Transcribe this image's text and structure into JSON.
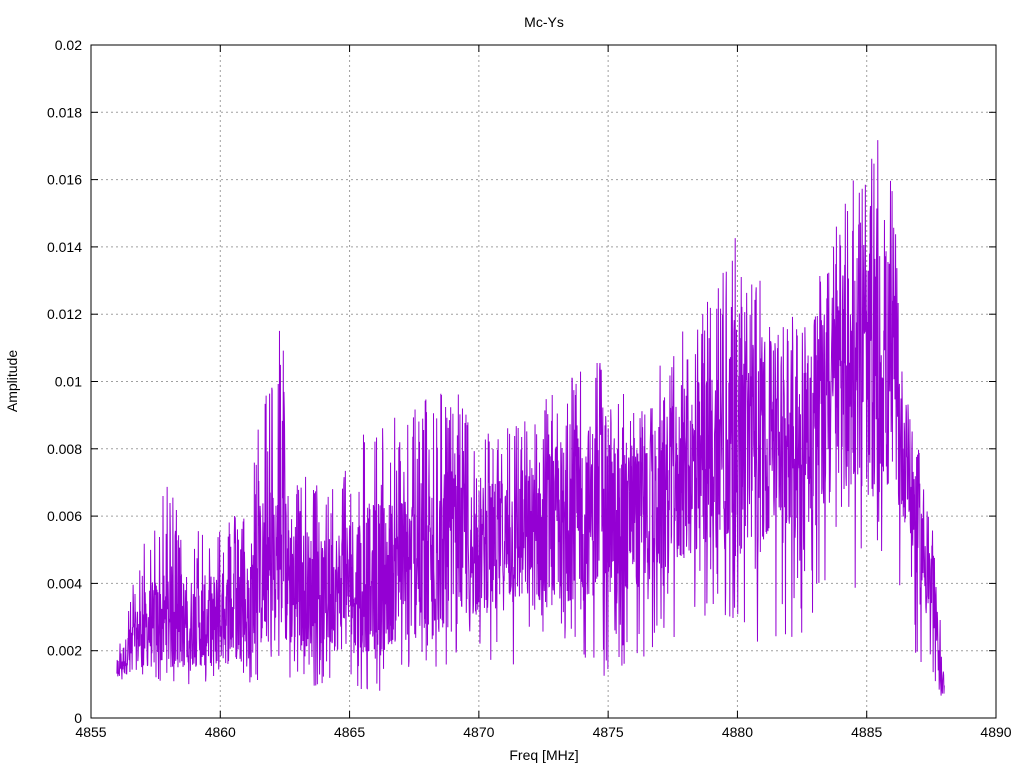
{
  "chart_data": {
    "type": "line",
    "title": "Mc-Ys",
    "xlabel": "Freq [MHz]",
    "ylabel": "Amplitude",
    "xlim": [
      4855,
      4890
    ],
    "ylim": [
      0,
      0.02
    ],
    "x_ticks": [
      "4855",
      "4860",
      "4865",
      "4870",
      "4875",
      "4880",
      "4885",
      "4890"
    ],
    "y_ticks": [
      "0",
      "0.002",
      "0.004",
      "0.006",
      "0.008",
      "0.01",
      "0.012",
      "0.014",
      "0.016",
      "0.018",
      "0.02"
    ],
    "grid": true,
    "line_color": "#9400d3",
    "series": [
      {
        "x_start": 4856,
        "x_end": 4888,
        "envelope": [
          [
            4856.0,
            0.0014,
            0.001,
            0.002
          ],
          [
            4857.0,
            0.0025,
            0.0012,
            0.0052
          ],
          [
            4858.0,
            0.0028,
            0.001,
            0.007
          ],
          [
            4859.0,
            0.0027,
            0.001,
            0.0058
          ],
          [
            4860.0,
            0.0028,
            0.0008,
            0.006
          ],
          [
            4861.0,
            0.003,
            0.001,
            0.0062
          ],
          [
            4861.5,
            0.004,
            0.001,
            0.009
          ],
          [
            4862.3,
            0.0045,
            0.0012,
            0.012
          ],
          [
            4863.0,
            0.0038,
            0.0008,
            0.0075
          ],
          [
            4864.0,
            0.0035,
            0.001,
            0.0068
          ],
          [
            4865.0,
            0.0038,
            0.0008,
            0.0085
          ],
          [
            4866.0,
            0.004,
            0.0005,
            0.0088
          ],
          [
            4867.0,
            0.0042,
            0.001,
            0.009
          ],
          [
            4868.0,
            0.0045,
            0.0012,
            0.0098
          ],
          [
            4869.0,
            0.0048,
            0.0015,
            0.01
          ],
          [
            4870.0,
            0.0048,
            0.0015,
            0.0085
          ],
          [
            4871.0,
            0.005,
            0.0015,
            0.0088
          ],
          [
            4872.0,
            0.0052,
            0.0012,
            0.009
          ],
          [
            4873.0,
            0.0055,
            0.001,
            0.01
          ],
          [
            4874.0,
            0.006,
            0.0015,
            0.011
          ],
          [
            4875.0,
            0.0058,
            0.001,
            0.0105
          ],
          [
            4876.0,
            0.0058,
            0.0012,
            0.0092
          ],
          [
            4877.0,
            0.0062,
            0.002,
            0.0105
          ],
          [
            4878.0,
            0.007,
            0.0025,
            0.012
          ],
          [
            4879.0,
            0.0075,
            0.003,
            0.0125
          ],
          [
            4880.0,
            0.0078,
            0.002,
            0.0148
          ],
          [
            4881.0,
            0.008,
            0.002,
            0.0128
          ],
          [
            4882.0,
            0.008,
            0.002,
            0.012
          ],
          [
            4883.0,
            0.0085,
            0.003,
            0.0125
          ],
          [
            4884.0,
            0.0095,
            0.0035,
            0.0168
          ],
          [
            4884.8,
            0.01,
            0.004,
            0.016
          ],
          [
            4885.8,
            0.01,
            0.004,
            0.018
          ],
          [
            4886.5,
            0.0075,
            0.003,
            0.01
          ],
          [
            4887.0,
            0.0055,
            0.0015,
            0.008
          ],
          [
            4887.5,
            0.0035,
            0.0012,
            0.006
          ],
          [
            4888.0,
            0.0008,
            0.0003,
            0.0015
          ]
        ]
      }
    ]
  }
}
